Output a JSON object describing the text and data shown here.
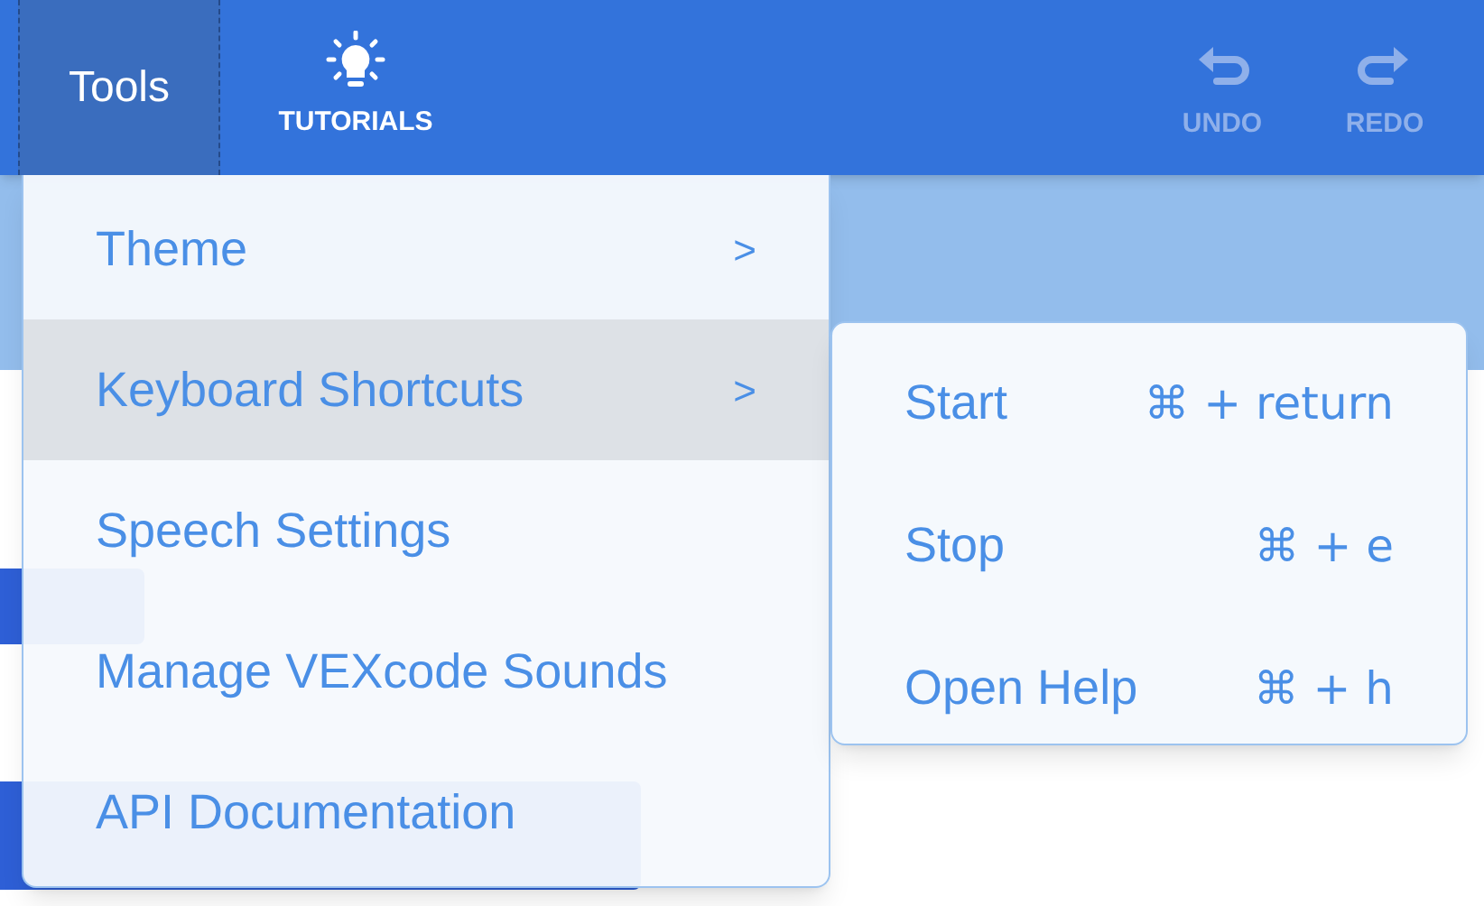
{
  "toolbar": {
    "menu": {
      "label": "Tools",
      "selected": true
    },
    "tutorials": {
      "label": "TUTORIALS"
    },
    "actions": [
      {
        "kind": "undo",
        "label": "UNDO",
        "disabled": true
      },
      {
        "kind": "redo",
        "label": "REDO",
        "disabled": true
      }
    ]
  },
  "menu": {
    "items": [
      {
        "label": "Theme",
        "arrow": ">",
        "selected": false
      },
      {
        "label": "Keyboard Shortcuts",
        "arrow": ">",
        "selected": true
      },
      {
        "label": "Speech Settings",
        "selected": false
      },
      {
        "label": "Manage VEXcode Sounds",
        "selected": false
      },
      {
        "label": "API Documentation",
        "selected": false
      }
    ]
  },
  "submenu": {
    "items": [
      {
        "label": "Start",
        "shortcut": "⌘ + return"
      },
      {
        "label": "Stop",
        "shortcut": "⌘ + e"
      },
      {
        "label": "Open Help",
        "shortcut": "⌘ + h"
      }
    ]
  }
}
